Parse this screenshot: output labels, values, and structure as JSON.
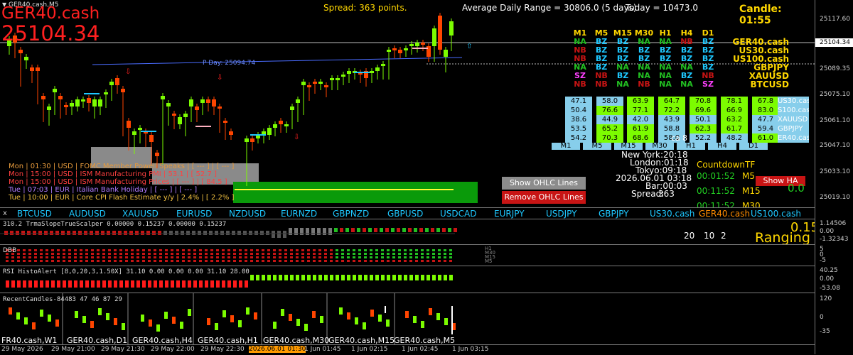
{
  "window": {
    "title": "GER40.cash,M5"
  },
  "header": {
    "symbol": "GER40.cash",
    "price": "25104.34",
    "spread": "Spread: 363 points.",
    "adr": "Average Daily Range = 30806.0 (5 days)",
    "today": "Today = 10473.0",
    "candle": "Candle:  01:55",
    "pday": "P Day: 25094.74"
  },
  "colors": {
    "up": "#7cfc00",
    "down": "#ff4500",
    "red": "#ff2020",
    "yellow": "#ffd700",
    "cyan": "#1ec8ff",
    "skyblue": "#87ceeb"
  },
  "price_axis": {
    "ticks": [
      "25117.60",
      "25104.34",
      "25089.35",
      "25075.10",
      "25061.10",
      "25047.10",
      "25033.10",
      "25019.10"
    ]
  },
  "signals": {
    "timeframes": [
      "M1",
      "M5",
      "M15",
      "M30",
      "H1",
      "H4",
      "D1"
    ],
    "rows": [
      {
        "symbol": "GER40.cash",
        "cells": [
          "NA",
          "BZ",
          "BZ",
          "NA",
          "NA",
          "NB",
          "BZ"
        ]
      },
      {
        "symbol": "US30.cash",
        "cells": [
          "NB",
          "BZ",
          "BZ",
          "BZ",
          "BZ",
          "BZ",
          "BZ"
        ]
      },
      {
        "symbol": "US100.cash",
        "cells": [
          "NB",
          "BZ",
          "BZ",
          "BZ",
          "BZ",
          "BZ",
          "BZ"
        ]
      },
      {
        "symbol": "GBPJPY",
        "cells": [
          "NA",
          "BZ",
          "NA",
          "NA",
          "NA",
          "NA",
          "BZ"
        ]
      },
      {
        "symbol": "XAUUSD",
        "cells": [
          "SZ",
          "NB",
          "BZ",
          "NA",
          "NA",
          "BZ",
          "NB"
        ]
      },
      {
        "symbol": "BTCUSD",
        "cells": [
          "NB",
          "NB",
          "NA",
          "NB",
          "NA",
          "NA",
          "SZ"
        ]
      }
    ]
  },
  "rsi_grid": {
    "rows": [
      {
        "symbol": "US30.cas",
        "values": [
          "47.1",
          "58.0",
          "63.9",
          "64.7",
          "70.8",
          "78.1",
          "67.8"
        ]
      },
      {
        "symbol": "S100.cas",
        "values": [
          "50.4",
          "76.6",
          "77.1",
          "72.2",
          "69.6",
          "66.9",
          "83.0"
        ]
      },
      {
        "symbol": "XAUUSD",
        "values": [
          "38.6",
          "44.9",
          "42.0",
          "43.9",
          "50.1",
          "63.2",
          "47.7"
        ]
      },
      {
        "symbol": "GBPJPY",
        "values": [
          "53.5",
          "65.2",
          "61.9",
          "58.8",
          "62.3",
          "61.7",
          "59.4"
        ]
      },
      {
        "symbol": "ER40.cas",
        "values": [
          "54.2",
          "70.3",
          "68.6",
          "58.0",
          "52.2",
          "48.2",
          "61.0"
        ]
      }
    ],
    "tf_buttons": [
      "M1",
      "M5",
      "M15",
      "M30",
      "H1",
      "H4",
      "D1"
    ]
  },
  "clock": {
    "extra": "ca",
    "extra_val": "8",
    "new_york": "New York:20:18",
    "london": "London:01:18",
    "tokyo": "Tokyo:09:18",
    "date": "2026.06.01 03:18",
    "bar": "Bar:00:03",
    "spread_label": "Spread:",
    "spread_val": "363"
  },
  "countdown": {
    "title": "CountdownTF",
    "rows": [
      {
        "time": "00:01:52",
        "tf": "M5"
      },
      {
        "time": "00:11:52",
        "tf": "M15"
      },
      {
        "time": "00:11:52",
        "tf": "M30"
      }
    ],
    "ha_button": "Show HA",
    "ha_value": "0.0"
  },
  "buttons": {
    "show_ohlc": "Show OHLC Lines",
    "remove_ohlc": "Remove OHLC Lines"
  },
  "news": [
    {
      "text": "Mon  |  01:30  |  USD  |  FOMC Member Powell Speaks  |  [ --- ]  |  [ --- ]",
      "color": "#e69a3c"
    },
    {
      "text": "Mon  |  15:00  |  USD  |  ISM Manufacturing PMI  |  53.1  |  [ 52.7 ]",
      "color": "#ff4040"
    },
    {
      "text": "Mon  |  15:00  |  USD  |  ISM Manufacturing Prices  |  [ --- ]  |  [ 84.5 ]",
      "color": "#ff4040"
    },
    {
      "text": "Tue  |  07:03  |  EUR  |  Italian Bank Holiday  |  [ --- ]  |  [ --- ]",
      "color": "#b07cff"
    },
    {
      "text": "Tue  |  10:00  |  EUR  |  Core CPI Flash Estimate y/y  |  2.4%  |  [ 2.2% ]",
      "color": "#f0c040"
    }
  ],
  "symbol_bar": {
    "close": "x",
    "items": [
      "BTCUSD",
      "AUDUSD",
      "XAUUSD",
      "EURUSD",
      "NZDUSD",
      "EURNZD",
      "GBPNZD",
      "GBPUSD",
      "USDCAD",
      "EURJPY",
      "USDJPY",
      "GBPJPY",
      "US30.cash",
      "GER40.cash",
      "US100.cash"
    ]
  },
  "ind1": {
    "label": "310.2 TrmaSlopeTrueScalper 0.00000 0.15237 0.00000 0.15237",
    "value": "0.15",
    "state": "Ranging",
    "nums": [
      "20",
      "10",
      "2"
    ],
    "axis": [
      "1.14506",
      "0.00",
      "-1.32343"
    ]
  },
  "ind2": {
    "label": "DBB",
    "tfs": [
      "H1",
      "M30",
      "M15",
      "M5"
    ],
    "axis": [
      "5",
      "0",
      "-5"
    ]
  },
  "ind3": {
    "label": "RSI HistoAlert [8,0,20,3,1.50X] 31.10 0.00 0.00 0.00 31.10 28.00",
    "axis": [
      "40.25",
      "0.00",
      "-53.08"
    ]
  },
  "ind4": {
    "label": "RecentCandles-84483 47 46 87 29",
    "charts": [
      "FR40.cash,W1",
      "GER40.cash,D1",
      "GER40.cash,H4",
      "GER40.cash,H1",
      "GER40.cash,M30",
      "GER40.cash,M15",
      "GER40.cash,M5"
    ],
    "axis": [
      "120",
      "0",
      "-35"
    ]
  },
  "time_axis": {
    "labels": [
      "29 May 2026",
      "29 May 21:00",
      "29 May 21:30",
      "29 May 22:00",
      "29 May 22:30",
      "2026.06.01 01:30",
      "1 Jun 01:45",
      "1 Jun 02:15",
      "1 Jun 02:45",
      "1 Jun 03:15"
    ]
  }
}
